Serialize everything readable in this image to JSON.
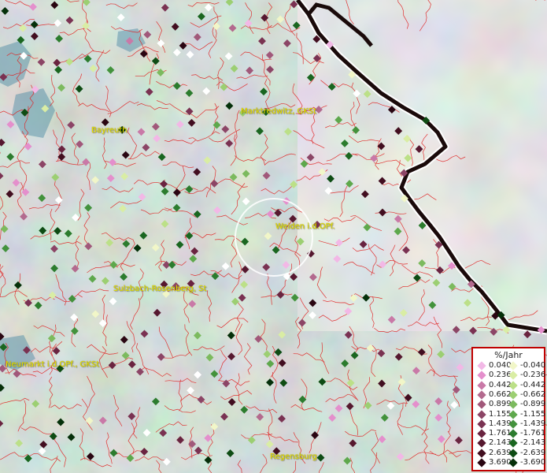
{
  "map": {
    "cities": [
      {
        "id": "bayreuth",
        "label": "Bayreuth"
      },
      {
        "id": "marktredwitz",
        "label": "Marktredwitz, GKSt"
      },
      {
        "id": "weiden",
        "label": "Weiden i.d.OPf."
      },
      {
        "id": "sulzbach",
        "label": "Sulzbach-Rosenberg, St"
      },
      {
        "id": "neumarkt",
        "label": "Neumarkt i.d.OPf., GKSt"
      },
      {
        "id": "regensburg",
        "label": "Regensburg"
      }
    ],
    "colors": {
      "district_borders": "#e02020",
      "country_border": "#1a0a0a",
      "label_text": "#e8e000",
      "highlight_circle": "#ffffff"
    }
  },
  "legend": {
    "title": "%/Jahr",
    "positive": [
      {
        "value": "0.040",
        "color": "#f2b8e6"
      },
      {
        "value": "0.236",
        "color": "#e48fcc"
      },
      {
        "value": "0.442",
        "color": "#c979a7"
      },
      {
        "value": "0.662",
        "color": "#b36a8e"
      },
      {
        "value": "0.899",
        "color": "#a1587a"
      },
      {
        "value": "1.155",
        "color": "#8c4566"
      },
      {
        "value": "1.439",
        "color": "#7a3252"
      },
      {
        "value": "1.761",
        "color": "#6a2440"
      },
      {
        "value": "2.143",
        "color": "#56182f"
      },
      {
        "value": "2.639",
        "color": "#420e20"
      },
      {
        "value": "3.690",
        "color": "#2a0612"
      }
    ],
    "negative": [
      {
        "value": "-0.040",
        "color": "#f1f6c8"
      },
      {
        "value": "-0.236",
        "color": "#d9eda4"
      },
      {
        "value": "-0.442",
        "color": "#bce088"
      },
      {
        "value": "-0.662",
        "color": "#9ccf72"
      },
      {
        "value": "-0.899",
        "color": "#7cba5e"
      },
      {
        "value": "-1.155",
        "color": "#5ea84c"
      },
      {
        "value": "-1.439",
        "color": "#43923c"
      },
      {
        "value": "-1.761",
        "color": "#2c7c2e"
      },
      {
        "value": "-2.143",
        "color": "#1a6620"
      },
      {
        "value": "-2.639",
        "color": "#0e4c14"
      },
      {
        "value": "-3.690",
        "color": "#05300a"
      }
    ]
  }
}
